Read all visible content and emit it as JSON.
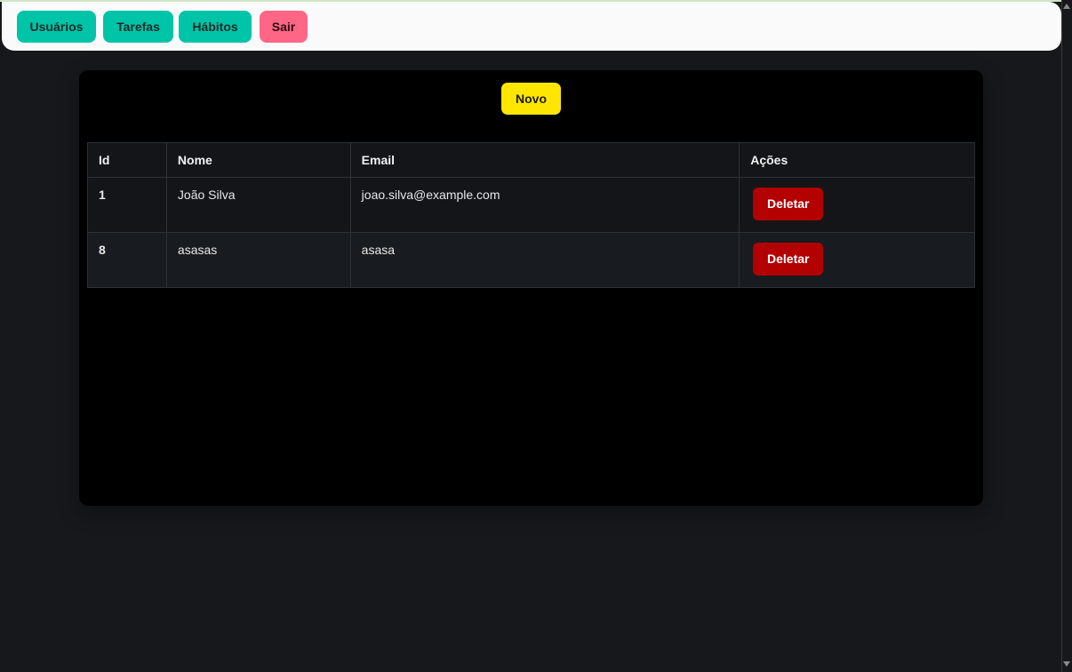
{
  "nav": {
    "users": "Usuários",
    "tasks": "Tarefas",
    "habits": "Hábitos",
    "logout": "Sair"
  },
  "panel": {
    "new_button": "Novo"
  },
  "table": {
    "headers": {
      "id": "Id",
      "name": "Nome",
      "email": "Email",
      "actions": "Ações"
    },
    "rows": [
      {
        "id": "1",
        "name": "João Silva",
        "email": "joao.silva@example.com",
        "action": "Deletar"
      },
      {
        "id": "8",
        "name": "asasas",
        "email": "asasa",
        "action": "Deletar"
      }
    ]
  },
  "colors": {
    "nav_button": "#00c4a7",
    "logout_button": "#ff6685",
    "new_button": "#ffe600",
    "delete_button": "#b30000",
    "page_background": "#17181b",
    "panel_background": "#000000"
  }
}
